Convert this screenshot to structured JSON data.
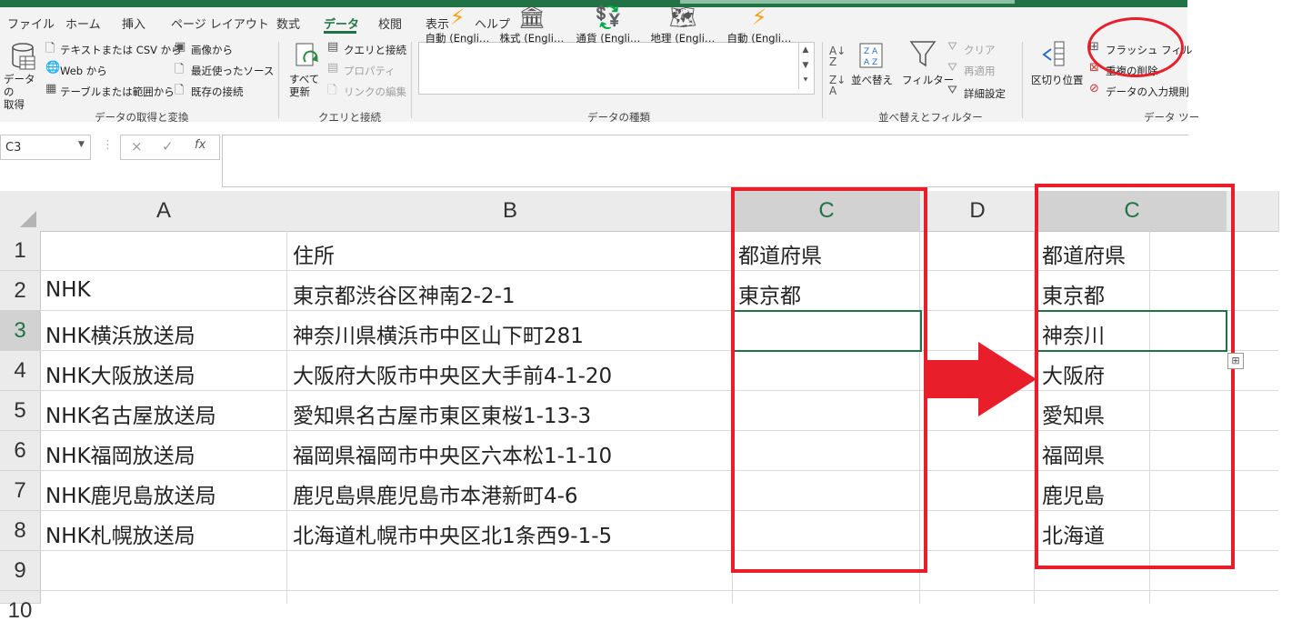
{
  "ribbon": {
    "tabs": [
      "ファイル",
      "ホーム",
      "挿入",
      "ページ レイアウト",
      "数式",
      "データ",
      "校閲",
      "表示",
      "ヘルプ"
    ],
    "active_tab": "データ",
    "get_data": {
      "button": "データの\n取得",
      "items": [
        "テキストまたは CSV から",
        "Web から",
        "テーブルまたは範囲から",
        "画像から",
        "最近使ったソース",
        "既存の接続"
      ],
      "group_label": "データの取得と変換"
    },
    "queries": {
      "refresh_all": "すべて\n更新",
      "items": [
        "クエリと接続",
        "プロパティ",
        "リンクの編集"
      ],
      "group_label": "クエリと接続"
    },
    "data_types": {
      "items": [
        "自動 (Engli…",
        "株式 (Engli…",
        "通貨 (Engli…",
        "地理 (Engli…",
        "自動 (Engli…"
      ],
      "group_label": "データの種類"
    },
    "sort_filter": {
      "sort": "並べ替え",
      "filter": "フィルター",
      "items": [
        "クリア",
        "再適用",
        "詳細設定"
      ],
      "group_label": "並べ替えとフィルター"
    },
    "data_tools": {
      "text_to_columns": "区切り位置",
      "items": [
        "フラッシュ フィル",
        "重複の削除",
        "データの入力規則"
      ],
      "group_label": "データ ツー"
    }
  },
  "formula_bar": {
    "name_box": "C3",
    "icons": [
      "×",
      "✓",
      "fx"
    ],
    "formula": ""
  },
  "sheet": {
    "columns": [
      "A",
      "B",
      "C",
      "D"
    ],
    "rows": [
      "1",
      "2",
      "3",
      "4",
      "5",
      "6",
      "7",
      "8",
      "9",
      "10"
    ],
    "cells_a": [
      "",
      "NHK",
      "NHK横浜放送局",
      "NHK大阪放送局",
      "NHK名古屋放送局",
      "NHK福岡放送局",
      "NHK鹿児島放送局",
      "NHK札幌放送局"
    ],
    "cells_b": [
      "住所",
      "東京都渋谷区神南2-2-1",
      "神奈川県横浜市中区山下町281",
      "大阪府大阪市中央区大手前4-1-20",
      "愛知県名古屋市東区東桜1-13-3",
      "福岡県福岡市中央区六本松1-1-10",
      "鹿児島県鹿児島市本港新町4-6",
      "北海道札幌市中央区北1条西9-1-5"
    ],
    "cells_c_before": [
      "都道府県",
      "東京都"
    ],
    "selected_cell": "C3"
  },
  "result_panel": {
    "column": "C",
    "cells": [
      "都道府県",
      "東京都",
      "神奈川",
      "大阪府",
      "愛知県",
      "福岡県",
      "鹿児島",
      "北海道"
    ]
  },
  "colors": {
    "excel_green": "#217346",
    "annotation_red": "#e81f2a"
  }
}
